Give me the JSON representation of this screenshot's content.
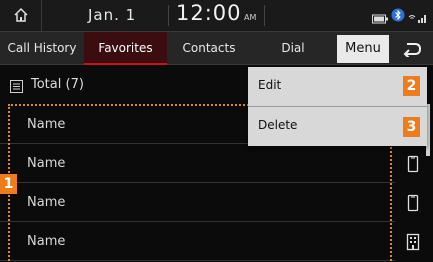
{
  "status_bar": {
    "date": "Jan. 1",
    "time": "12:00",
    "ampm": "AM",
    "icons": [
      "home-icon",
      "battery-icon",
      "bluetooth-icon",
      "signal-icon"
    ]
  },
  "tabs": [
    {
      "label": "Call History",
      "active": false
    },
    {
      "label": "Favorites",
      "active": true
    },
    {
      "label": "Contacts",
      "active": false
    },
    {
      "label": "Dial",
      "active": false
    }
  ],
  "menu_label": "Menu",
  "list": {
    "total_label": "Total (7)",
    "rows": [
      {
        "name": "Name",
        "icon": "none"
      },
      {
        "name": "Name",
        "icon": "mobile-phone-icon"
      },
      {
        "name": "Name",
        "icon": "mobile-phone-icon"
      },
      {
        "name": "Name",
        "icon": "office-phone-icon"
      }
    ]
  },
  "dropdown": {
    "items": [
      {
        "label": "Edit",
        "badge": "2"
      },
      {
        "label": "Delete",
        "badge": "3"
      }
    ]
  },
  "callouts": {
    "list_badge": "1"
  },
  "colors": {
    "accent_red": "#c4161c",
    "callout_orange": "#ee7b1c",
    "background": "#0b0b0b",
    "menu_bg": "#d8d8d8"
  }
}
